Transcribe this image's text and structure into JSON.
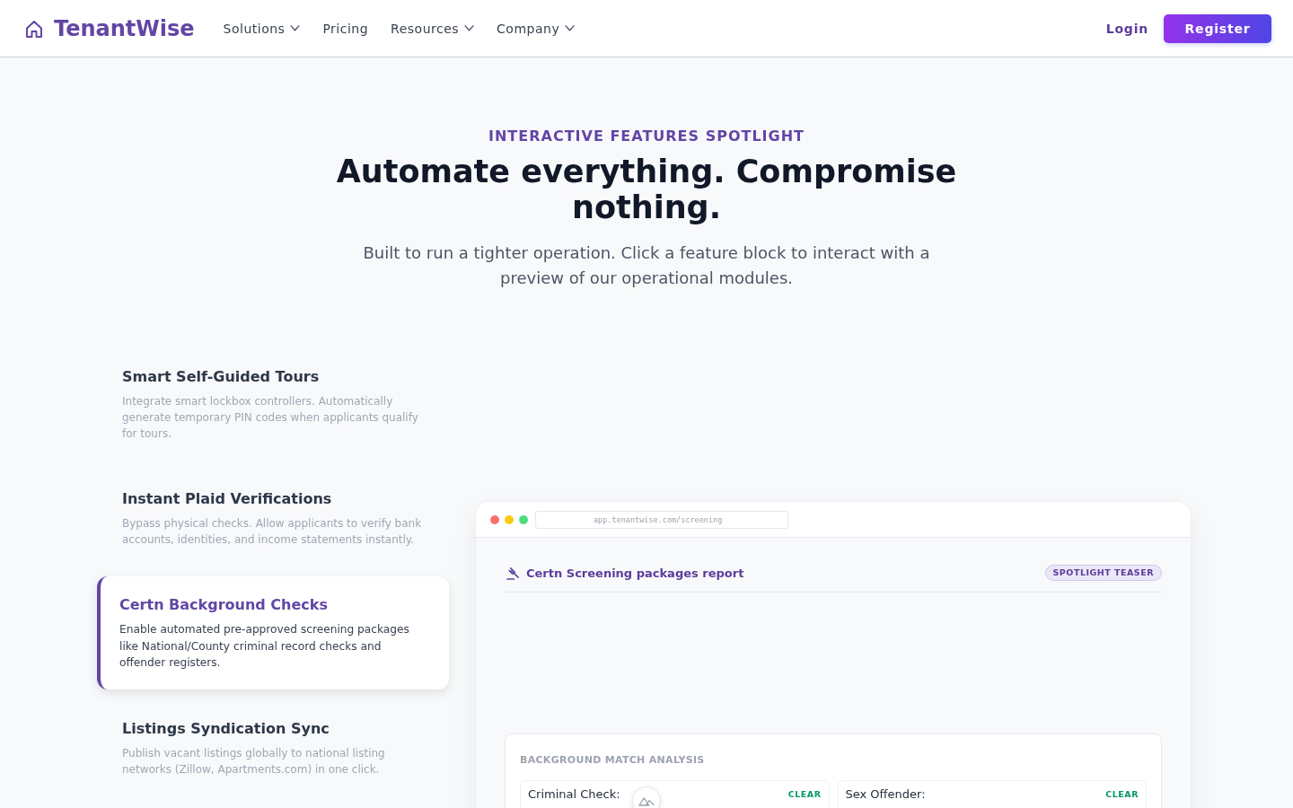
{
  "nav": {
    "logo": "TenantWise",
    "links": [
      {
        "label": "Solutions",
        "dropdown": true
      },
      {
        "label": "Pricing",
        "dropdown": false
      },
      {
        "label": "Resources",
        "dropdown": true
      },
      {
        "label": "Company",
        "dropdown": true
      }
    ],
    "login": "Login",
    "register": "Register"
  },
  "hero": {
    "eyebrow": "INTERACTIVE FEATURES SPOTLIGHT",
    "title": "Automate everything. Compromise nothing.",
    "subtitle": "Built to run a tighter operation. Click a feature block to interact with a preview of our operational modules."
  },
  "features": [
    {
      "title": "Smart Self-Guided Tours",
      "description": "Integrate smart lockbox controllers. Automatically generate temporary PIN codes when applicants qualify for tours.",
      "selected": false
    },
    {
      "title": "Instant Plaid Verifications",
      "description": "Bypass physical checks. Allow applicants to verify bank accounts, identities, and income statements instantly.",
      "selected": false
    },
    {
      "title": "Certn Background Checks",
      "description": "Enable automated pre-approved screening packages like National/County criminal record checks and offender registers.",
      "selected": true
    },
    {
      "title": "Listings Syndication Sync",
      "description": "Publish vacant listings globally to national listing networks (Zillow, Apartments.com) in one click.",
      "selected": false
    }
  ],
  "preview": {
    "url": "app.tenantwise.com/screening",
    "report_title": "Certn Screening packages report",
    "badge": "SPOTLIGHT TEASER",
    "analysis_title": "BACKGROUND MATCH ANALYSIS",
    "checks": [
      {
        "label": "Criminal Check:",
        "result": "CLEAR"
      },
      {
        "label": "Sex Offender:",
        "result": "CLEAR"
      }
    ]
  }
}
